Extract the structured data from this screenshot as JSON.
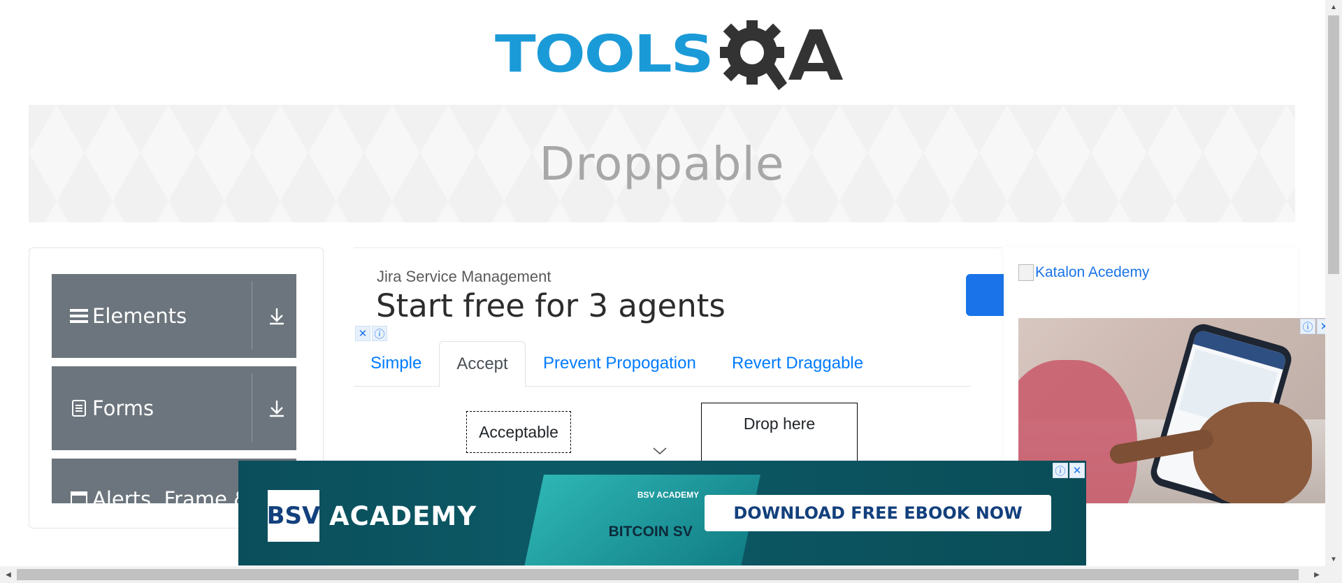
{
  "header": {
    "logo_text": "TOOLS",
    "logo_suffix": "A"
  },
  "banner": {
    "title": "Droppable"
  },
  "sidebar": {
    "groups": [
      {
        "label": "Elements",
        "icon": "hamburger-icon"
      },
      {
        "label": "Forms",
        "icon": "document-icon"
      },
      {
        "label": "Alerts, Frame &",
        "icon": "window-icon"
      }
    ]
  },
  "ad_top": {
    "brand": "Jira Service Management",
    "headline": "Start free for 3 agents"
  },
  "tabs": [
    {
      "label": "Simple"
    },
    {
      "label": "Accept"
    },
    {
      "label": "Prevent Propogation"
    },
    {
      "label": "Revert Draggable"
    }
  ],
  "drag": {
    "draggable_label": "Acceptable",
    "drop_label": "Drop here"
  },
  "ad_right": {
    "link_text": "Katalon Acedemy"
  },
  "ad_bottom": {
    "logo": "BSV",
    "academy": "ACADEMY",
    "book_title": "BITCOIN SV",
    "book_badge": "BSV ACADEMY",
    "cta": "DOWNLOAD FREE EBOOK NOW"
  },
  "colors": {
    "logo_blue": "#1b9ad8",
    "logo_dark": "#333333",
    "sidebar_bg": "#6c757d",
    "link_blue": "#007bff",
    "ad_teal": "#0b4e5b"
  }
}
